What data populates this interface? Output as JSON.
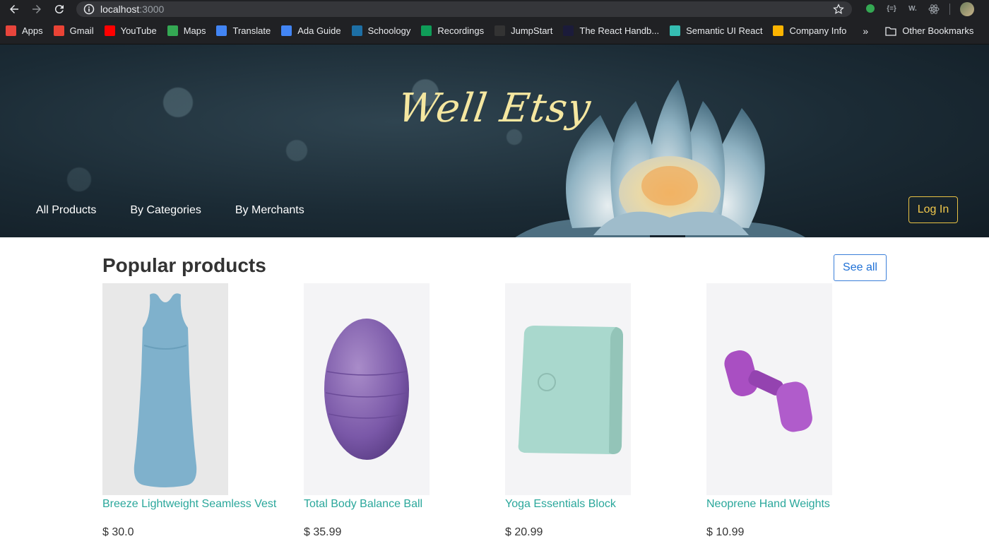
{
  "browser": {
    "url_host": "localhost",
    "url_port": ":3000",
    "bookmarks": [
      {
        "label": "Apps",
        "icon": "apps-grid-icon",
        "color": "#e8453c"
      },
      {
        "label": "Gmail",
        "icon": "gmail-icon",
        "color": "#ea4335"
      },
      {
        "label": "YouTube",
        "icon": "youtube-icon",
        "color": "#ff0000"
      },
      {
        "label": "Maps",
        "icon": "maps-pin-icon",
        "color": "#34a853"
      },
      {
        "label": "Translate",
        "icon": "translate-icon",
        "color": "#4285f4"
      },
      {
        "label": "Ada Guide",
        "icon": "doc-icon",
        "color": "#4285f4"
      },
      {
        "label": "Schoology",
        "icon": "schoology-icon",
        "color": "#1d6fa5"
      },
      {
        "label": "Recordings",
        "icon": "sheet-icon",
        "color": "#0f9d58"
      },
      {
        "label": "JumpStart",
        "icon": "github-icon",
        "color": "#333333"
      },
      {
        "label": "The React Handb...",
        "icon": "react-handbook-icon",
        "color": "#1b1b3a"
      },
      {
        "label": "Semantic UI React",
        "icon": "semantic-ui-icon",
        "color": "#35bdb2"
      },
      {
        "label": "Company Info",
        "icon": "airtable-icon",
        "color": "#fcb400"
      }
    ],
    "more_label": "»",
    "other_bookmarks": "Other Bookmarks"
  },
  "hero": {
    "brand": "Well Etsy",
    "nav": [
      "All Products",
      "By Categories",
      "By Merchants"
    ],
    "login": "Log In"
  },
  "main": {
    "section_title": "Popular products",
    "see_all": "See all",
    "products": [
      {
        "name": "Breeze Lightweight Seamless Vest",
        "price": "$ 30.0",
        "image": "vest-image"
      },
      {
        "name": "Total Body Balance Ball",
        "price": "$ 35.99",
        "image": "balance-ball-image"
      },
      {
        "name": "Yoga Essentials Block",
        "price": "$ 20.99",
        "image": "yoga-block-image"
      },
      {
        "name": "Neoprene Hand Weights",
        "price": "$ 10.99",
        "image": "hand-weight-image"
      }
    ]
  },
  "colors": {
    "accent_teal": "#2aa79b",
    "login_gold": "#f2c94c",
    "see_all_blue": "#1e70d6"
  }
}
